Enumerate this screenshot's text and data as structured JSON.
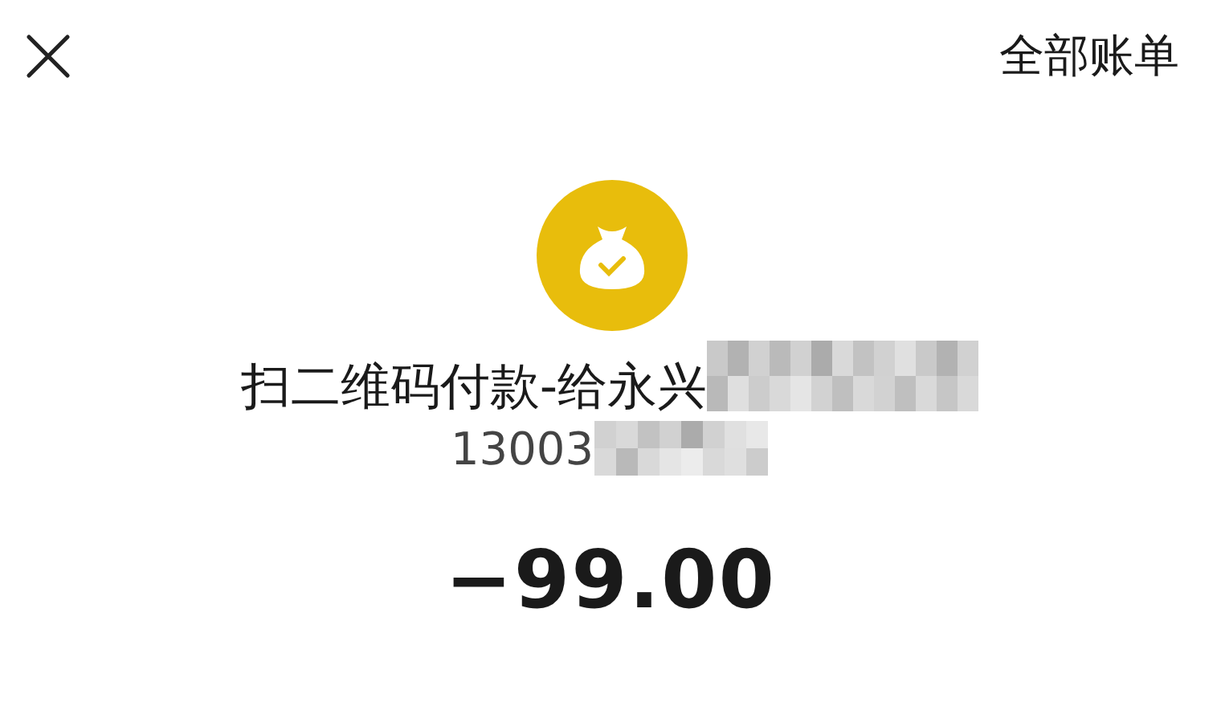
{
  "header": {
    "action": "全部账单"
  },
  "transaction": {
    "title": "扫二维码付款-给永兴",
    "account": "13003",
    "amount": "−99.00"
  }
}
